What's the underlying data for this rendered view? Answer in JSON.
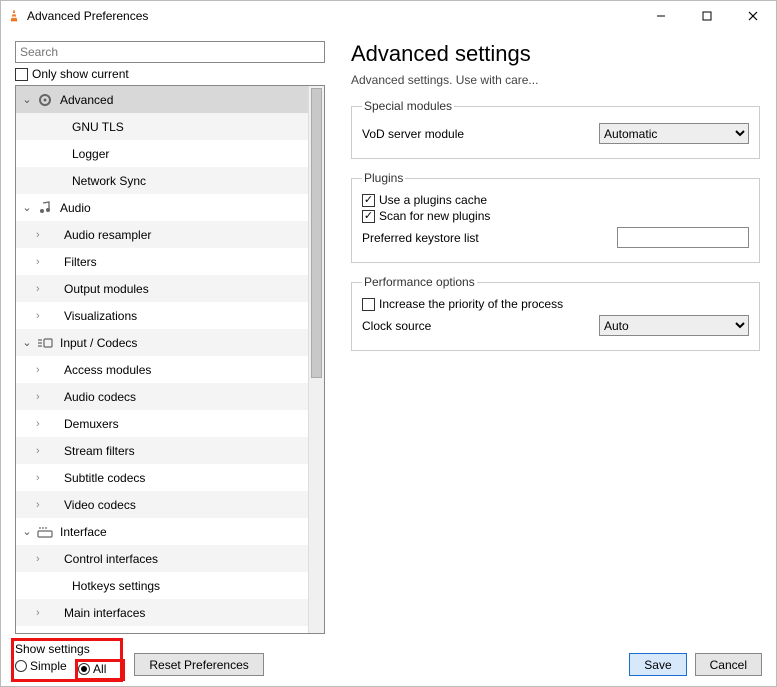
{
  "window": {
    "title": "Advanced Preferences"
  },
  "search": {
    "placeholder": "Search"
  },
  "only_show_current": "Only show current",
  "tree": {
    "advanced": {
      "label": "Advanced",
      "i0": "GNU TLS",
      "i1": "Logger",
      "i2": "Network Sync"
    },
    "audio": {
      "label": "Audio",
      "i0": "Audio resampler",
      "i1": "Filters",
      "i2": "Output modules",
      "i3": "Visualizations"
    },
    "input": {
      "label": "Input / Codecs",
      "i0": "Access modules",
      "i1": "Audio codecs",
      "i2": "Demuxers",
      "i3": "Stream filters",
      "i4": "Subtitle codecs",
      "i5": "Video codecs"
    },
    "interface": {
      "label": "Interface",
      "i0": "Control interfaces",
      "i1": "Hotkeys settings",
      "i2": "Main interfaces"
    }
  },
  "content": {
    "heading": "Advanced settings",
    "subheading": "Advanced settings. Use with care...",
    "special_modules": {
      "legend": "Special modules",
      "vod_label": "VoD server module",
      "vod_value": "Automatic"
    },
    "plugins": {
      "legend": "Plugins",
      "use_cache": "Use a plugins cache",
      "scan": "Scan for new plugins",
      "keystore_label": "Preferred keystore list",
      "keystore_value": ""
    },
    "perf": {
      "legend": "Performance options",
      "priority": "Increase the priority of the process",
      "clock_label": "Clock source",
      "clock_value": "Auto"
    }
  },
  "footer": {
    "show_settings": "Show settings",
    "simple": "Simple",
    "all": "All",
    "reset": "Reset Preferences",
    "save": "Save",
    "cancel": "Cancel"
  }
}
